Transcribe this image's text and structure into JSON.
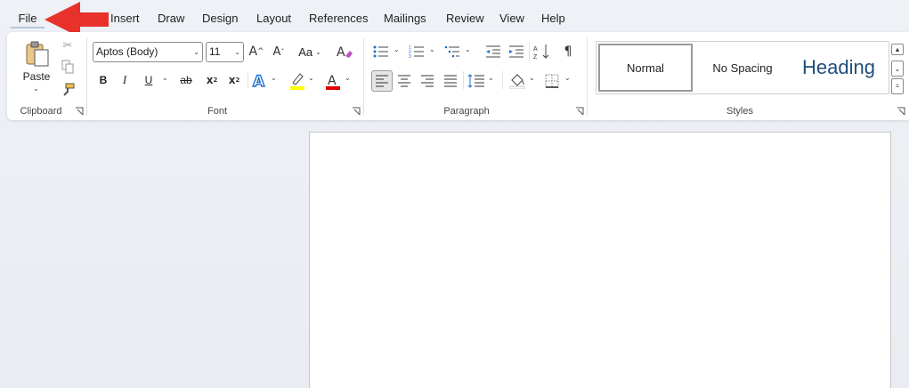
{
  "menu": {
    "file": "File",
    "items": [
      "Insert",
      "Draw",
      "Design",
      "Layout",
      "References",
      "Mailings",
      "Review",
      "View",
      "Help"
    ]
  },
  "clipboard": {
    "paste_label": "Paste",
    "group_label": "Clipboard"
  },
  "font": {
    "font_name": "Aptos (Body)",
    "font_size": "11",
    "group_label": "Font",
    "bold": "B",
    "italic": "I",
    "underline": "U",
    "strikethrough": "ab",
    "change_case": "Aa",
    "highlight_color": "#ffff00",
    "font_color": "#e00000",
    "text_effect_color": "#1e6fd0"
  },
  "paragraph": {
    "group_label": "Paragraph"
  },
  "styles": {
    "group_label": "Styles",
    "items": [
      "Normal",
      "No Spacing",
      "Heading"
    ]
  },
  "colors": {
    "arrow": "#e8312a",
    "heading": "#1f4e79"
  }
}
